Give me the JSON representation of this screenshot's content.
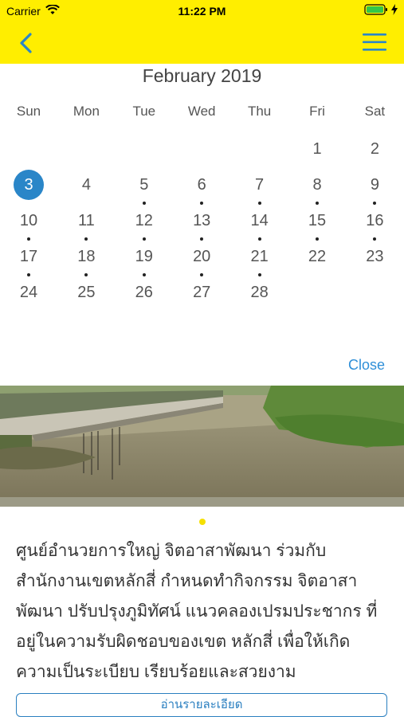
{
  "status_bar": {
    "carrier": "Carrier",
    "time": "11:22 PM"
  },
  "nav": {
    "back_icon": "chevron-left-icon",
    "menu_icon": "hamburger-menu-icon",
    "accent": "#ffee00",
    "icon_color": "#2a86c8"
  },
  "calendar": {
    "month_title": "February 2019",
    "weekdays": [
      "Sun",
      "Mon",
      "Tue",
      "Wed",
      "Thu",
      "Fri",
      "Sat"
    ],
    "weeks": [
      [
        null,
        null,
        null,
        null,
        null,
        {
          "d": "1",
          "dot": false
        },
        {
          "d": "2",
          "dot": false
        }
      ],
      [
        {
          "d": "3",
          "dot": false,
          "selected": true
        },
        {
          "d": "4",
          "dot": false
        },
        {
          "d": "5",
          "dot": true
        },
        {
          "d": "6",
          "dot": true
        },
        {
          "d": "7",
          "dot": true
        },
        {
          "d": "8",
          "dot": true
        },
        {
          "d": "9",
          "dot": true
        }
      ],
      [
        {
          "d": "10",
          "dot": true
        },
        {
          "d": "11",
          "dot": true
        },
        {
          "d": "12",
          "dot": true
        },
        {
          "d": "13",
          "dot": true
        },
        {
          "d": "14",
          "dot": true
        },
        {
          "d": "15",
          "dot": true
        },
        {
          "d": "16",
          "dot": true
        }
      ],
      [
        {
          "d": "17",
          "dot": true
        },
        {
          "d": "18",
          "dot": true
        },
        {
          "d": "19",
          "dot": true
        },
        {
          "d": "20",
          "dot": true
        },
        {
          "d": "21",
          "dot": true
        },
        {
          "d": "22",
          "dot": false
        },
        {
          "d": "23",
          "dot": false
        }
      ],
      [
        {
          "d": "24",
          "dot": false
        },
        {
          "d": "25",
          "dot": false
        },
        {
          "d": "26",
          "dot": false
        },
        {
          "d": "27",
          "dot": false
        },
        {
          "d": "28",
          "dot": false
        },
        null,
        null
      ]
    ],
    "selected_color": "#2a86c8",
    "close_label": "Close"
  },
  "news": {
    "image_icon": "photo-canal-landscape",
    "carousel_index": 1,
    "carousel_count": 1,
    "description": "ศูนย์อำนวยการใหญ่ จิตอาสาพัฒนา ร่วมกับ สำนักงานเขตหลักสี่ กำหนดทำกิจกรรม จิตอาสาพัฒนา ปรับปรุงภูมิทัศน์ แนวคลองเปรมประชากร ที่อยู่ในความรับผิดชอบของเขต หลักสี่ เพื่อให้เกิดความเป็นระเบียบ เรียบร้อยและสวยงาม",
    "more_label": "อ่านรายละเอียด"
  }
}
